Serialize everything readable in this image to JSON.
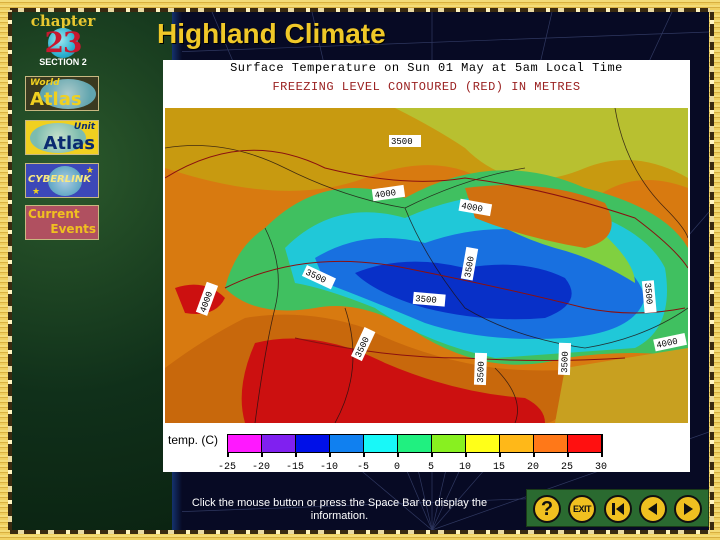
{
  "window": {
    "title": "Highland Climate"
  },
  "logo": {
    "chapter_label": "chapter",
    "chapter_number": "23",
    "section_label": "SECTION 2"
  },
  "sidebar": {
    "items": [
      {
        "id": "world-atlas",
        "line1": "World",
        "line2": "Atlas"
      },
      {
        "id": "unit-atlas",
        "line1": "Unit",
        "line2": "Atlas"
      },
      {
        "id": "cyberlink",
        "line1": "CYBERLINK",
        "line2": ""
      },
      {
        "id": "current-events",
        "line1": "Current",
        "line2": "Events"
      }
    ]
  },
  "map": {
    "caption_line1": "Surface Temperature on Sun 01 May at 5am Local Time",
    "caption_line2": "FREEZING LEVEL CONTOURED (RED) IN METRES",
    "contour_labels": [
      "3500",
      "4000",
      "4000",
      "3500",
      "4000",
      "3500",
      "3500",
      "3500",
      "3500",
      "3500",
      "3500",
      "4000"
    ]
  },
  "legend": {
    "title": "temp. (C)",
    "ticks": [
      "-25",
      "-20",
      "-15",
      "-10",
      "-5",
      "0",
      "5",
      "10",
      "15",
      "20",
      "25",
      "30"
    ],
    "colors": [
      "#ff18ff",
      "#8020f0",
      "#0010e8",
      "#1080f0",
      "#18f8f8",
      "#20f080",
      "#88f020",
      "#ffff18",
      "#ffb818",
      "#ff7818",
      "#ff1010"
    ]
  },
  "footer": {
    "instruction": "Click the mouse button or press the Space Bar to display the information."
  },
  "nav": {
    "help_label": "?",
    "exit_label": "EXIT",
    "first_icon": "skip-to-start-icon",
    "prev_icon": "previous-icon",
    "next_icon": "next-icon"
  }
}
